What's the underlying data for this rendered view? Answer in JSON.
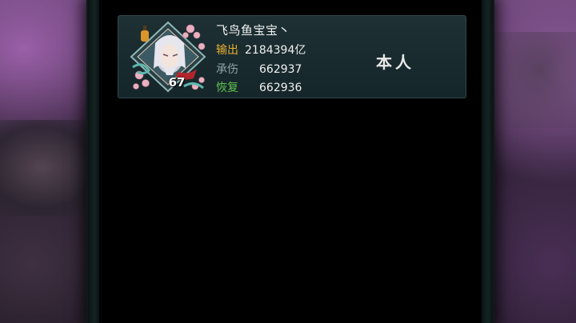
{
  "player": {
    "name": "飞鸟鱼宝宝丶",
    "level": "67",
    "tag": "本人",
    "stats": {
      "output_label": "输出",
      "output_value": "2184394亿",
      "taken_label": "承伤",
      "taken_value": "662937",
      "heal_label": "恢复",
      "heal_value": "662936"
    }
  },
  "colors": {
    "output_label": "#e8b030",
    "taken_label": "#8ea4a8",
    "heal_label": "#5fc24f"
  },
  "icons": {
    "avatar": "character-portrait-icon",
    "frame": "cherry-blossom-frame"
  }
}
